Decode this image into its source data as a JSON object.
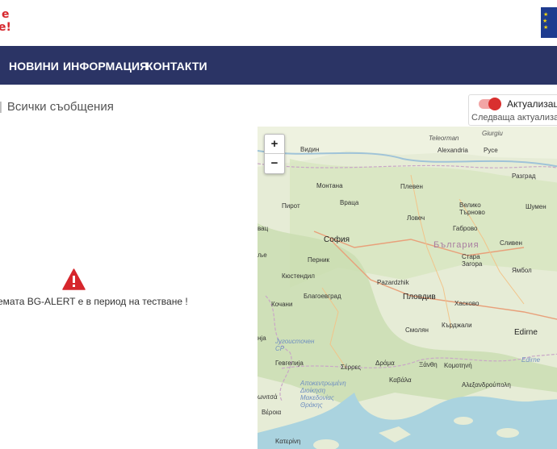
{
  "header": {
    "logo_lines": [
      "е",
      "е!"
    ]
  },
  "nav": {
    "items": [
      "НОВИНИ",
      "ИНФОРМАЦИЯ",
      "КОНТАКТИ"
    ]
  },
  "breadcrumb": {
    "sep": "|",
    "current": "Всички съобщения"
  },
  "update_toggle": {
    "label": "Актуализация",
    "next_update": "Следваща актуализация",
    "state": "on"
  },
  "notice": {
    "text": "емата BG-ALERT е в период на тестване !",
    "icon": "warning-icon",
    "color": "#d6262c"
  },
  "map": {
    "zoom_in": "+",
    "zoom_out": "−",
    "country_label": "България",
    "cities": {
      "giurgiu": "Giurgiu",
      "teleorman": "Teleorman",
      "alexandria": "Alexandria",
      "ruse": "Русе",
      "vidin": "Видин",
      "montana": "Монтана",
      "pleven": "Плевен",
      "razgrad": "Разград",
      "vratsa": "Враца",
      "veliko": "Велико\nТърново",
      "shumen": "Шумен",
      "pirot": "Пирот",
      "lovech": "Ловеч",
      "gabrovo": "Габрово",
      "vac": "вац",
      "sofia": "София",
      "sliven": "Сливен",
      "pernik": "Перник",
      "stara": "Стара\nЗагора",
      "yambol": "Ямбол",
      "kyustendil": "Кюстендил",
      "pazardzhik": "Pazardzhik",
      "plovdiv": "Пловдив",
      "blagoevgrad": "Благоевград",
      "haskovo": "Хасково",
      "kochani": "Кочани",
      "smolyan": "Смолян",
      "kardzhali": "Кърджали",
      "edirne": "Edirne",
      "edirne2": "Edirne",
      "nja": "нја",
      "jugoistochen": "Југоисточен\nСР",
      "gevgelija": "Гевгелија",
      "serres": "Σέρρες",
      "drama": "Δράμα",
      "xanthi": "Ξάνθη",
      "komotini": "Κομοτηνή",
      "kavala": "Καβάλα",
      "alexandroupoli": "Αλεξανδρούπολη",
      "apokentromeni": "Αποκεντρωμένη\nΔιοίκηση\nΜακεδονίας\nΘράκης",
      "kilkis": "ωνιτσά",
      "veria": "Βέροια",
      "katerini": "Κατερίνη",
      "rje": "ље"
    }
  }
}
